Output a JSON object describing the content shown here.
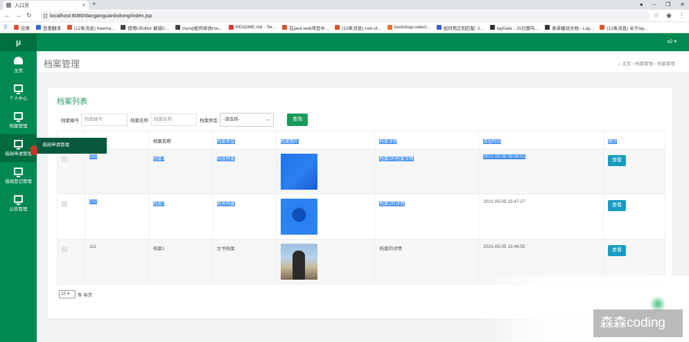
{
  "browser": {
    "tab_title": "入口页",
    "tab_close": "×",
    "new_tab": "+",
    "url": "localhost:8080/danganguanlixitong/index.jsp",
    "bookmarks": [
      {
        "label": "应用",
        "color": "#e24c3b"
      },
      {
        "label": "百度翻译",
        "color": "#2b6de0"
      },
      {
        "label": "(12条消息) freema...",
        "color": "#d9542b"
      },
      {
        "label": "使用UEditor 报错C...",
        "color": "#444444"
      },
      {
        "label": "mysql如何修改roo...",
        "color": "#444444"
      },
      {
        "label": "README.md - Ter...",
        "color": "#e23b3b"
      },
      {
        "label": "在java web项目中...",
        "color": "#d9542b"
      },
      {
        "label": "(12条消息) root of...",
        "color": "#d9542b"
      },
      {
        "label": "bootstrap-select...",
        "color": "#e0782b"
      },
      {
        "label": "如何用正则匹配: 2...",
        "color": "#3b5bd9"
      },
      {
        "label": "layDate - JS日期与...",
        "color": "#333333"
      },
      {
        "label": "表单模块文档 - Lay...",
        "color": "#333333"
      },
      {
        "label": "(12条消息) 关于lay...",
        "color": "#d9542b"
      }
    ]
  },
  "app": {
    "logo": "μ",
    "user": "a2 ▾",
    "sidebar": [
      {
        "label": "主页",
        "icon": "dashboard-icon"
      },
      {
        "label": "个人中心",
        "icon": "monitor-icon"
      },
      {
        "label": "档案管理",
        "icon": "monitor-icon"
      },
      {
        "label": "借阅申请管理",
        "icon": "monitor-icon"
      },
      {
        "label": "借阅登记管理",
        "icon": "monitor-icon"
      },
      {
        "label": "公告管理",
        "icon": "monitor-icon"
      }
    ],
    "tooltip": "借阅申请管理",
    "page_title": "档案管理",
    "breadcrumb": "⌂ 主页 › 档案管理 › 档案管理"
  },
  "panel": {
    "title": "档案列表",
    "search": {
      "label_code": "档案编号",
      "placeholder_code": "档案编号",
      "label_name": "档案名称",
      "placeholder_name": "档案名称",
      "label_type": "档案类型",
      "select_value": "-请选择-",
      "button": "查询"
    },
    "columns": [
      "",
      "档案编号",
      "档案名称",
      "档案类型",
      "档案图片",
      "档案详情",
      "添加时间",
      "操作"
    ],
    "rows": [
      {
        "code": "333",
        "name": "档案3",
        "type": "科技档案",
        "detail": "档案3的档案详情",
        "time": "2021-05-06 09:08:51",
        "action": "查看"
      },
      {
        "code": "222",
        "name": "档案2",
        "type": "财务档案",
        "detail": "档案2的详情",
        "time": "2021-05-05 13:47:27",
        "action": "查看"
      },
      {
        "code": "111",
        "name": "档案1",
        "type": "文书档案",
        "detail": "档案的详情",
        "time": "2021-05-05 13:46:55",
        "action": "查看"
      }
    ],
    "pager": {
      "size": "10",
      "suffix": "条 每页"
    }
  },
  "watermark": "森森coding"
}
